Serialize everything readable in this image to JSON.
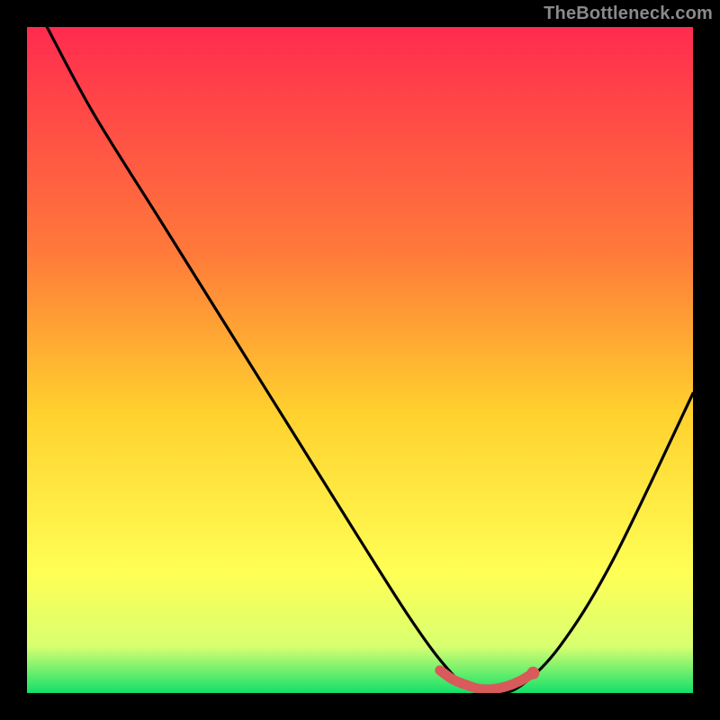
{
  "watermark": "TheBottleneck.com",
  "colors": {
    "top": "#ff2b4f",
    "mid_upper": "#ff7a3a",
    "mid": "#ffd12e",
    "mid_lower": "#ffff55",
    "lower_band": "#d8ff70",
    "bottom": "#12e06a",
    "curve_stroke": "#000000",
    "marker_stroke": "#d85a5a",
    "marker_fill": "#d85a5a",
    "frame": "#000000"
  },
  "chart_data": {
    "type": "line",
    "title": "",
    "xlabel": "",
    "ylabel": "",
    "xlim": [
      0,
      100
    ],
    "ylim": [
      0,
      100
    ],
    "series": [
      {
        "name": "bottleneck-curve",
        "x": [
          3,
          10,
          20,
          30,
          40,
          50,
          57,
          62,
          66,
          70,
          74,
          80,
          88,
          100
        ],
        "y": [
          100,
          87,
          71,
          55,
          39,
          23,
          12,
          5,
          1,
          0,
          1,
          7,
          20,
          45
        ]
      }
    ],
    "markers": {
      "name": "optimal-range",
      "x": [
        62,
        64,
        66,
        68,
        70,
        72,
        74,
        76
      ],
      "y": [
        3.4,
        2.0,
        1.2,
        0.6,
        0.6,
        1.0,
        1.8,
        3.0
      ]
    },
    "marker_dot": {
      "x": 76,
      "y": 3.0
    }
  }
}
